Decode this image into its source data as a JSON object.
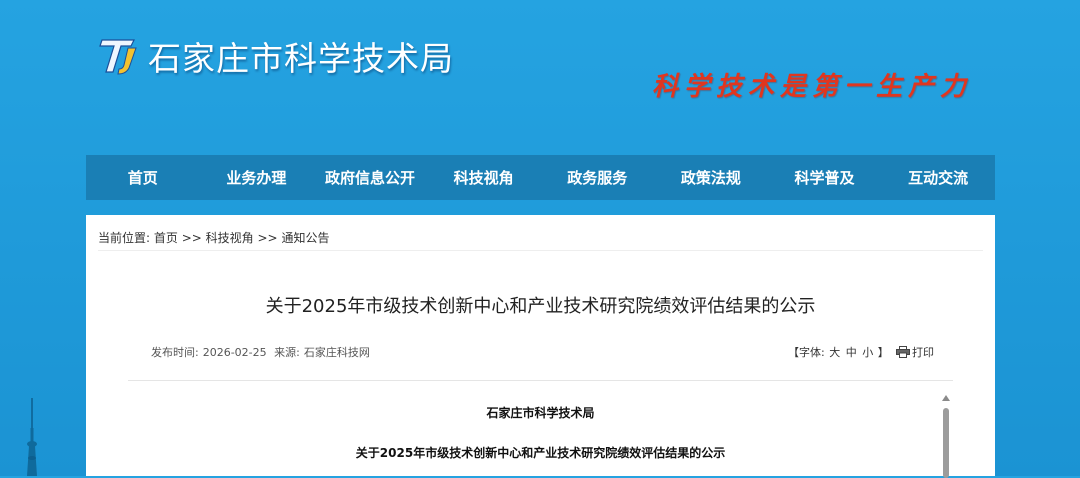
{
  "header": {
    "site_title": "石家庄市科学技术局",
    "slogan": "科学技术是第一生产力",
    "logo": "tj-logo-icon"
  },
  "nav": {
    "items": [
      {
        "label": "首页"
      },
      {
        "label": "业务办理"
      },
      {
        "label": "政府信息公开"
      },
      {
        "label": "科技视角"
      },
      {
        "label": "政务服务"
      },
      {
        "label": "政策法规"
      },
      {
        "label": "科学普及"
      },
      {
        "label": "互动交流"
      }
    ]
  },
  "breadcrumb": {
    "prefix": "当前位置:",
    "items": [
      "首页",
      "科技视角",
      "通知公告"
    ],
    "separator": ">>"
  },
  "article": {
    "title": "关于2025年市级技术创新中心和产业技术研究院绩效评估结果的公示",
    "publish_label": "发布时间:",
    "publish_date": "2026-02-25",
    "source_label": "来源:",
    "source": "石家庄科技网",
    "font_size_open": "【字体:",
    "font_large": "大",
    "font_medium": "中",
    "font_small": "小",
    "font_size_close": "】",
    "print_label": "打印",
    "body_org": "石家庄市科学技术局",
    "body_title": "关于2025年市级技术创新中心和产业技术研究院绩效评估结果的公示"
  },
  "colors": {
    "background": "#21a0de",
    "nav_bg": "#1a7fb5",
    "slogan": "#e0361f"
  }
}
